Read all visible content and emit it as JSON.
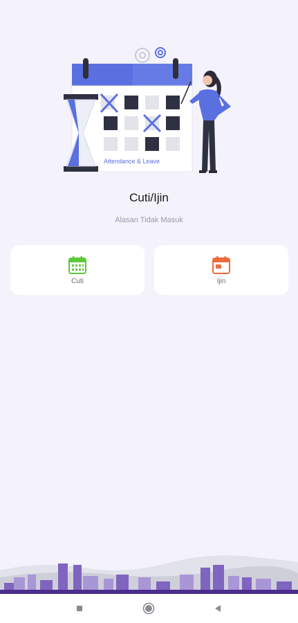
{
  "hero": {
    "illustration_caption": "Attendance & Leave"
  },
  "page": {
    "title": "Cuti/Ijin",
    "subtitle": "Alasan Tidak Masuk"
  },
  "menu": [
    {
      "label": "Cuti",
      "icon": "calendar-grid-icon",
      "color": "#5cc93a"
    },
    {
      "label": "Ijin",
      "icon": "calendar-event-icon",
      "color": "#f06b3a"
    }
  ],
  "navbar": {
    "buttons": [
      "recents-square-icon",
      "home-circle-icon",
      "back-triangle-icon"
    ]
  },
  "colors": {
    "background": "#f4f3fb",
    "accent": "#5a6fe0",
    "skyline": "#6c4fb0"
  }
}
